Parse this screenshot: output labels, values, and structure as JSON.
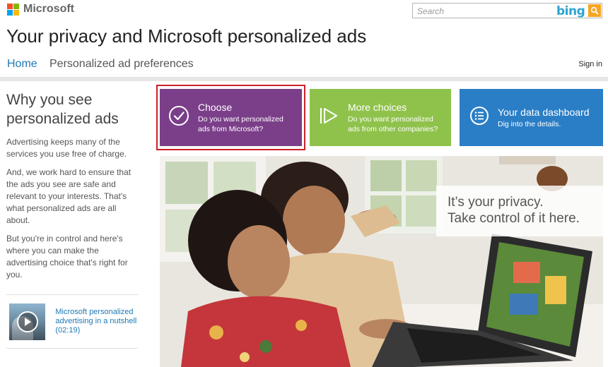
{
  "header": {
    "brand": "Microsoft",
    "search_placeholder": "Search",
    "search_brand": "bing"
  },
  "page_title": "Your privacy and Microsoft personalized ads",
  "nav": {
    "home": "Home",
    "preferences": "Personalized ad preferences",
    "sign_in": "Sign in"
  },
  "sidebar": {
    "heading_line1": "Why you see",
    "heading_line2": "personalized ads",
    "paragraphs": [
      "Advertising keeps many of the services you use free of charge.",
      "And, we work hard to ensure that the ads you see are safe and relevant to your interests. That's what personalized ads are all about.",
      "But you're in control and here's where you can make the advertising choice that's right for you."
    ],
    "video_link": "Microsoft personalized advertising in a nutshell (02:19)"
  },
  "tiles": [
    {
      "title": "Choose",
      "subtitle": "Do you want personalized ads from Microsoft?",
      "color": "#7b3f8a",
      "icon": "checkmark-circle-icon"
    },
    {
      "title": "More choices",
      "subtitle": "Do you want personalized ads from other companies?",
      "color": "#8fc24b",
      "icon": "play-forward-icon"
    },
    {
      "title": "Your data dashboard",
      "subtitle": "Dig into the details.",
      "color": "#2a7ec6",
      "icon": "list-circle-icon"
    }
  ],
  "hero": {
    "caption_line1": "It’s your privacy.",
    "caption_line2": "Take control of it here."
  },
  "colors": {
    "link": "#1f78b4",
    "highlight_frame": "#cc2028"
  }
}
